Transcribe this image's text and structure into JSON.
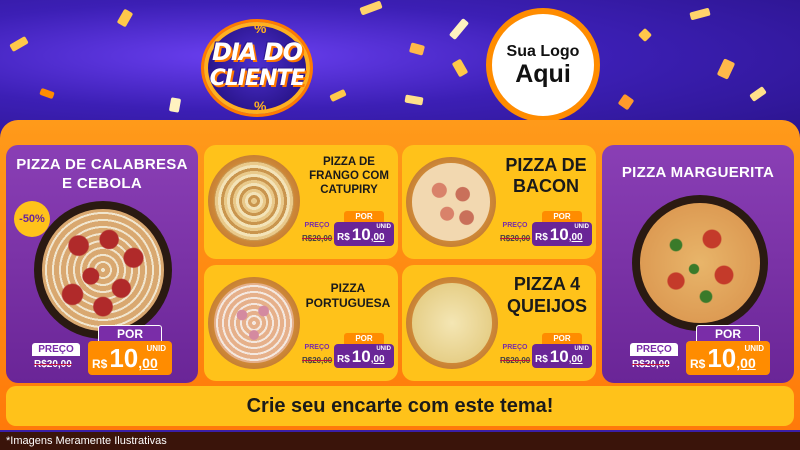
{
  "header": {
    "title_line1": "DIA DO",
    "title_line2": "CLIENTE",
    "percent_symbol": "%",
    "logo_line1": "Sua Logo",
    "logo_line2": "Aqui"
  },
  "colors": {
    "purple": "#7a2da8",
    "orange": "#ff8c00",
    "yellow": "#ffc21a",
    "price_red": "#c0123a"
  },
  "products": [
    {
      "name": "PIZZA DE CALABRESA E CEBOLA",
      "badge": "-50%",
      "preco_label": "PREÇO",
      "old_price": "R$20,00",
      "por_label": "POR",
      "currency": "R$",
      "price_int": "10",
      "price_dec": ",00",
      "unit": "UNID"
    },
    {
      "name": "PIZZA DE FRANGO COM CATUPIRY",
      "preco_label": "PREÇO",
      "old_price": "R$20,00",
      "por_label": "POR",
      "currency": "R$",
      "price_int": "10",
      "price_dec": ",00",
      "unit": "UNID"
    },
    {
      "name": "PIZZA DE BACON",
      "preco_label": "PREÇO",
      "old_price": "R$20,00",
      "por_label": "POR",
      "currency": "R$",
      "price_int": "10",
      "price_dec": ",00",
      "unit": "UNID"
    },
    {
      "name": "PIZZA MARGUERITA",
      "preco_label": "PREÇO",
      "old_price": "R$20,00",
      "por_label": "POR",
      "currency": "R$",
      "price_int": "10",
      "price_dec": ",00",
      "unit": "UNID"
    },
    {
      "name": "PIZZA PORTUGUESA",
      "preco_label": "PREÇO",
      "old_price": "R$20,00",
      "por_label": "POR",
      "currency": "R$",
      "price_int": "10",
      "price_dec": ",00",
      "unit": "UNID"
    },
    {
      "name": "PIZZA 4 QUEIJOS",
      "preco_label": "PREÇO",
      "old_price": "R$20,00",
      "por_label": "POR",
      "currency": "R$",
      "price_int": "10",
      "price_dec": ",00",
      "unit": "UNID"
    }
  ],
  "cta": "Crie seu encarte com este tema!",
  "footer": "*Imagens Meramente Ilustrativas"
}
